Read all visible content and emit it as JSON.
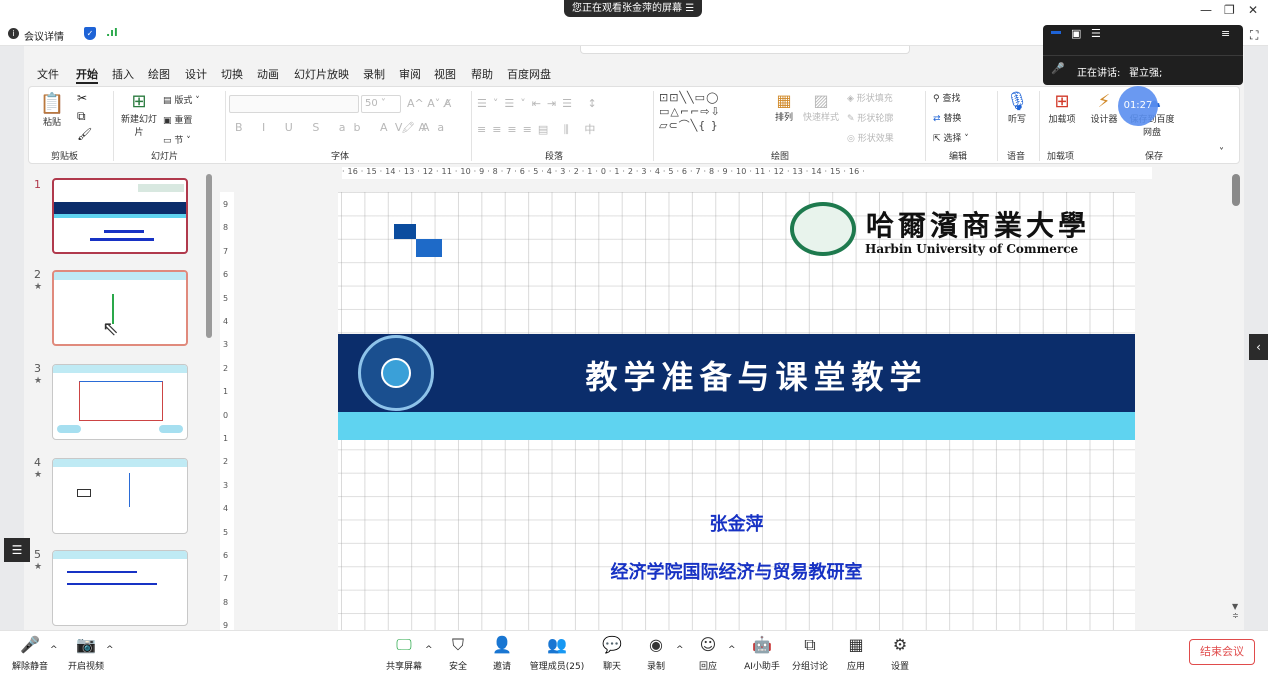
{
  "top": {
    "sharing_banner": "您正在观看张金萍的屏幕"
  },
  "info": {
    "meeting_details": "会议详情"
  },
  "speaker_panel": {
    "speaking_label": "正在讲话:",
    "speaker_name": "翟立强;"
  },
  "timer": "01:27",
  "menu": [
    "文件",
    "开始",
    "插入",
    "绘图",
    "设计",
    "切换",
    "动画",
    "幻灯片放映",
    "录制",
    "审阅",
    "视图",
    "帮助",
    "百度网盘"
  ],
  "ribbon": {
    "paste": "粘贴",
    "new_slide": "新建幻灯片",
    "layout": "版式",
    "reset": "重置",
    "section": "节",
    "font_size": "50",
    "arrange": "排列",
    "quick_styles": "快速样式",
    "shape_fill": "形状填充",
    "shape_outline": "形状轮廓",
    "shape_effects": "形状效果",
    "find": "查找",
    "replace": "替换",
    "select": "选择",
    "dictate": "听写",
    "addins": "加载项",
    "designer": "设计器",
    "save_baidu": "保存到百度网盘",
    "groups": {
      "clipboard": "剪贴板",
      "slides": "幻灯片",
      "font": "字体",
      "paragraph": "段落",
      "drawing": "绘图",
      "editing": "编辑",
      "voice": "语音",
      "addins": "加载项",
      "save": "保存"
    }
  },
  "thumbnails": [
    {
      "num": "1",
      "star": ""
    },
    {
      "num": "2",
      "star": "★"
    },
    {
      "num": "3",
      "star": "★"
    },
    {
      "num": "4",
      "star": "★"
    },
    {
      "num": "5",
      "star": "★"
    }
  ],
  "ruler": {
    "h": "· 16 · 15 · 14 · 13 · 12 · 11 · 10 · 9 · 8 · 7 · 6 · 5 · 4 · 3 · 2 · 1 · 0 · 1 · 2 · 3 · 4 · 5 · 6 · 7 · 8 · 9 · 10 · 11 · 12 · 13 · 14 · 15 · 16 ·",
    "v": [
      "9",
      "8",
      "7",
      "6",
      "5",
      "4",
      "3",
      "2",
      "1",
      "0",
      "1",
      "2",
      "3",
      "4",
      "5",
      "6",
      "7",
      "8",
      "9"
    ]
  },
  "slide": {
    "logo_cn": "哈爾濱商業大學",
    "logo_en": "Harbin University of Commerce",
    "title": "教学准备与课堂教学",
    "presenter": "张金萍",
    "department": "经济学院国际经济与贸易教研室"
  },
  "bottom": {
    "tools": [
      {
        "label": "解除静音",
        "icon": "mic-off-icon"
      },
      {
        "label": "开启视频",
        "icon": "camera-off-icon"
      },
      {
        "label": "共享屏幕",
        "icon": "share-screen-icon"
      },
      {
        "label": "安全",
        "icon": "shield-icon"
      },
      {
        "label": "邀请",
        "icon": "invite-icon"
      },
      {
        "label": "管理成员(25)",
        "icon": "members-icon"
      },
      {
        "label": "聊天",
        "icon": "chat-icon"
      },
      {
        "label": "录制",
        "icon": "record-icon"
      },
      {
        "label": "回应",
        "icon": "reaction-icon"
      },
      {
        "label": "AI小助手",
        "icon": "ai-assistant-icon"
      },
      {
        "label": "分组讨论",
        "icon": "breakout-icon"
      },
      {
        "label": "应用",
        "icon": "apps-icon"
      },
      {
        "label": "设置",
        "icon": "settings-icon"
      }
    ],
    "end_meeting": "结束会议"
  },
  "colors": {
    "accent": "#1e63d6",
    "slide_band": "#0b2d6b",
    "slide_band_light": "#5fd3f0",
    "slide_text": "#1732c4",
    "end_button": "#e04b4b"
  }
}
